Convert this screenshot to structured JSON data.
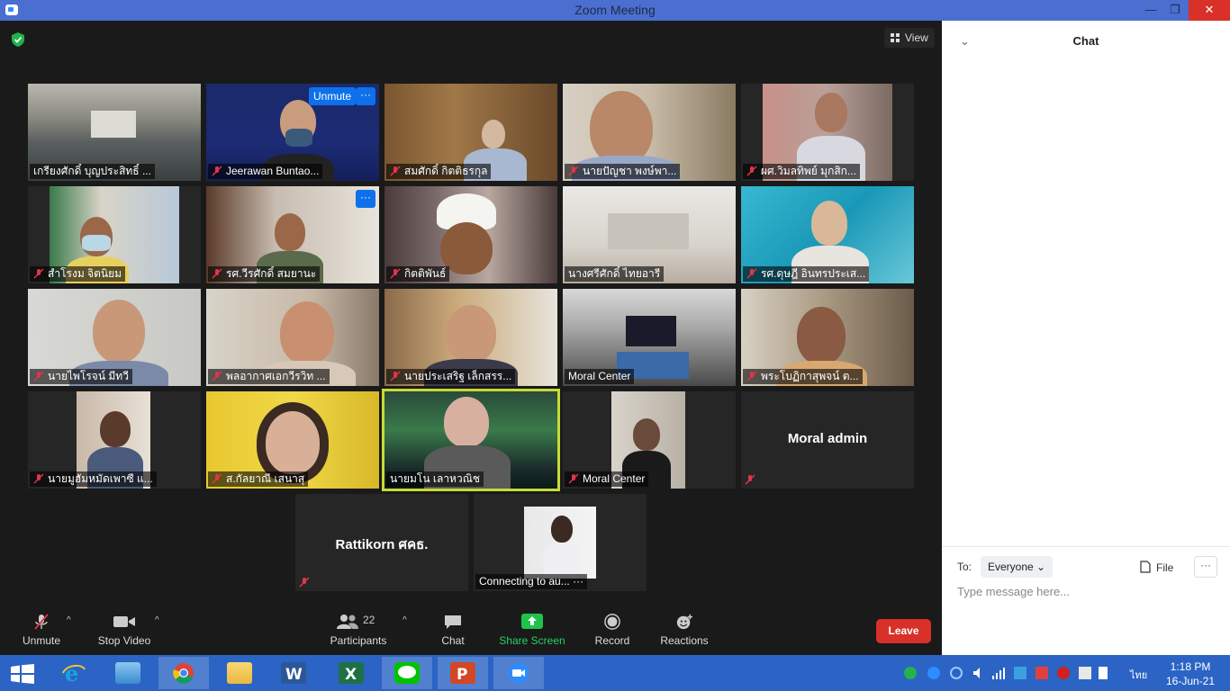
{
  "window": {
    "title": "Zoom Meeting",
    "minimize": "—",
    "restore": "❐",
    "close": "✕"
  },
  "view_button": {
    "label": "View"
  },
  "tiles": [
    {
      "name": "เกรียงศักดิ์ บุญประสิทธิ์ ...",
      "muted": false
    },
    {
      "name": "Jeerawan Buntao...",
      "muted": true,
      "overlay_unmute": "Unmute",
      "overlay_more": "···"
    },
    {
      "name": "สมศักดิ์ กิตติธรกุล",
      "muted": true
    },
    {
      "name": "นายปัญชา พงษ์พา...",
      "muted": true
    },
    {
      "name": "ผศ.วิมลทิพย์ มุกสิก...",
      "muted": true
    },
    {
      "name": "สำโรงม จิตนิยม",
      "muted": true
    },
    {
      "name": "รศ.วีรศักดิ์ สมยานะ",
      "muted": true,
      "overlay_more": "···"
    },
    {
      "name": "กิตติพันธ์",
      "muted": true
    },
    {
      "name": "นางศรีศักดิ์ ไทยอารี",
      "muted": false
    },
    {
      "name": "รศ.ดุษฎี อินทรประเส...",
      "muted": true
    },
    {
      "name": "นายไพโรจน์ มีทวี",
      "muted": true
    },
    {
      "name": "พลอากาศเอกวีรวิท ...",
      "muted": true
    },
    {
      "name": "นายประเสริฐ เล็กสรร...",
      "muted": true
    },
    {
      "name": "Moral Center",
      "muted": false
    },
    {
      "name": "พระโบฏิกาสุพจน์ ต...",
      "muted": true
    },
    {
      "name": "นายมูฮัมหมัดเพาซี แ...",
      "muted": true
    },
    {
      "name": "ส.กัลยาณี เสนาสุ",
      "muted": true
    },
    {
      "name": "นายมโน เลาหวณิช",
      "muted": false
    },
    {
      "name": "Moral Center",
      "muted": true
    },
    {
      "name": "",
      "muted": true,
      "big_name": "Moral admin"
    },
    {
      "name": "",
      "muted": true,
      "big_name": "Rattikorn ศคธ."
    },
    {
      "name": "Connecting to au...",
      "muted": false,
      "dots": "···"
    }
  ],
  "toolbar": {
    "unmute": "Unmute",
    "stop_video": "Stop Video",
    "participants": "Participants",
    "participants_count": "22",
    "chat": "Chat",
    "share_screen": "Share Screen",
    "record": "Record",
    "reactions": "Reactions",
    "leave": "Leave",
    "caret": "^"
  },
  "chat_panel": {
    "title": "Chat",
    "collapse": "⌄",
    "to_label": "To:",
    "recipient": "Everyone",
    "recipient_caret": "⌄",
    "file": "File",
    "more": "···",
    "placeholder": "Type message here..."
  },
  "taskbar": {
    "clock_time": "1:18 PM",
    "clock_date": "16-Jun-21",
    "lang": "ไทย"
  },
  "colors": {
    "accent": "#0e71eb",
    "leave": "#d9302a",
    "share": "#20c34a",
    "active_speaker": "#c6dc33",
    "taskbar": "#2b64c4"
  }
}
